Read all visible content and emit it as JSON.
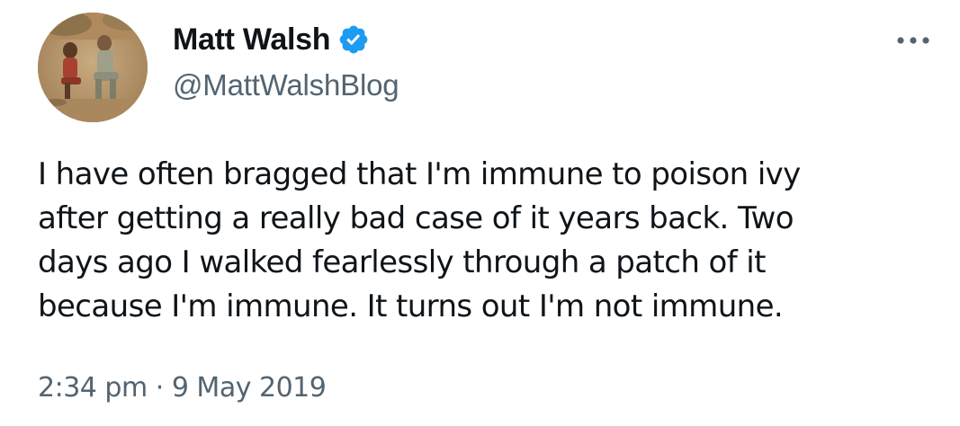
{
  "author": {
    "display_name": "Matt Walsh",
    "handle": "@MattWalshBlog",
    "verified": true
  },
  "tweet": {
    "text": "I have often bragged that I'm immune to poison ivy\nafter getting a really bad case of it years back. Two\ndays ago I walked fearlessly through a patch of it\nbecause I'm immune. It turns out I'm not immune.",
    "time": "2:34 pm",
    "separator": "·",
    "date": "9 May 2019"
  },
  "icons": {
    "verified": "verified-badge-icon",
    "more": "more-options-icon"
  },
  "colors": {
    "verified_blue": "#1d9bf0",
    "primary_text": "#0f1419",
    "secondary_text": "#536471",
    "background": "#ffffff"
  }
}
